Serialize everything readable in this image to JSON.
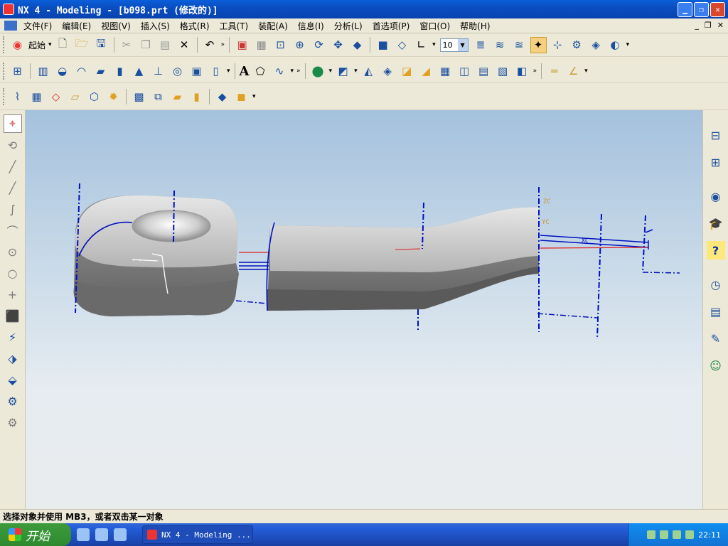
{
  "window": {
    "title": "NX 4 - Modeling - [b098.prt (修改的)]"
  },
  "menu": [
    "文件(F)",
    "编辑(E)",
    "视图(V)",
    "插入(S)",
    "格式(R)",
    "工具(T)",
    "装配(A)",
    "信息(I)",
    "分析(L)",
    "首选项(P)",
    "窗口(O)",
    "帮助(H)"
  ],
  "toolbar1": {
    "start_label": "起始",
    "zoom_value": "10"
  },
  "toolbar2": {
    "text_tool": "A"
  },
  "viewport": {
    "zc_label": "ZC",
    "yc_label": "YC",
    "xc_label": "XC"
  },
  "status": {
    "prompt": "选择对象并使用 MB3，或者双击某一对象"
  },
  "taskbar": {
    "start_label": "开始",
    "task_label": "NX 4 - Modeling ...",
    "clock": "22:11"
  },
  "colors": {
    "title_bar": "#0a4ec2",
    "dimension_blue": "#0010c0",
    "datum_red": "#e02020",
    "part_gray": "#8a8a8a"
  }
}
